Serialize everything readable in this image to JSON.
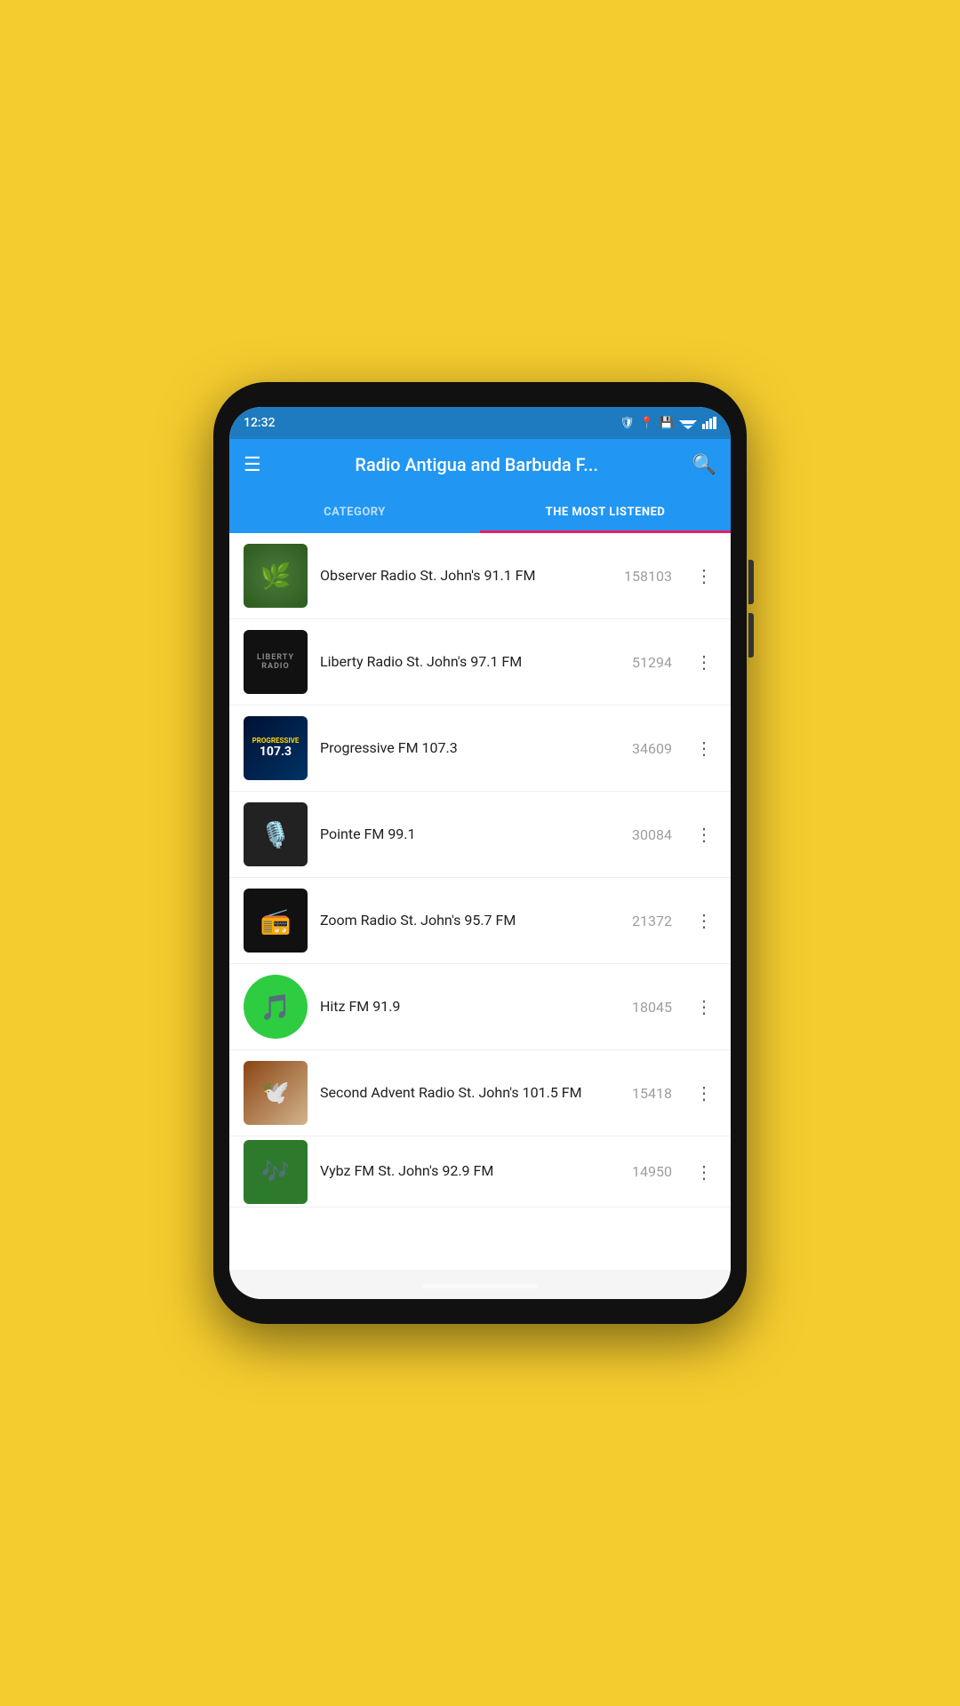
{
  "status": {
    "time": "12:32",
    "wifi": true,
    "signal": true
  },
  "appbar": {
    "title": "Radio Antigua and Barbuda F...",
    "menu_label": "☰",
    "search_label": "🔍"
  },
  "tabs": [
    {
      "id": "category",
      "label": "CATEGORY",
      "active": false
    },
    {
      "id": "most-listened",
      "label": "THE MOST LISTENED",
      "active": true
    }
  ],
  "stations": [
    {
      "id": 1,
      "name": "Observer Radio St. John's 91.1 FM",
      "count": "158103",
      "logo_type": "observer",
      "logo_emoji": "🌿"
    },
    {
      "id": 2,
      "name": "Liberty Radio St. John's 97.1 FM",
      "count": "51294",
      "logo_type": "liberty",
      "logo_text": "LIBERTY"
    },
    {
      "id": 3,
      "name": "Progressive FM 107.3",
      "count": "34609",
      "logo_type": "progressive",
      "logo_text": "PROGRESSIVE"
    },
    {
      "id": 4,
      "name": "Pointe FM 99.1",
      "count": "30084",
      "logo_type": "pointe",
      "logo_emoji": "🎙️"
    },
    {
      "id": 5,
      "name": "Zoom Radio St. John's 95.7 FM",
      "count": "21372",
      "logo_type": "zoom",
      "logo_emoji": "📻"
    },
    {
      "id": 6,
      "name": "Hitz FM 91.9",
      "count": "18045",
      "logo_type": "hitz",
      "logo_emoji": "🎵"
    },
    {
      "id": 7,
      "name": "Second Advent Radio St. John's 101.5 FM",
      "count": "15418",
      "logo_type": "second",
      "logo_emoji": "🕊️"
    },
    {
      "id": 8,
      "name": "Vybz FM St. John's 92.9 FM",
      "count": "14950",
      "logo_type": "vybz",
      "logo_emoji": "🎶"
    }
  ]
}
